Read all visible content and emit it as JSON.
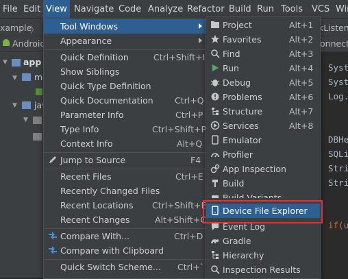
{
  "menubar": {
    "items": [
      "File",
      "Edit",
      "View",
      "Navigate",
      "Code",
      "Analyze",
      "Refactor",
      "Build",
      "Run",
      "Tools",
      "VCS",
      "Win"
    ],
    "active": "View"
  },
  "navbar": {
    "left": "xample",
    "right_tab": "kListen",
    "right_tab2": "onnectM"
  },
  "project_panel": {
    "root_label": "app",
    "tab_label": "Android",
    "items": [
      "m",
      "jav"
    ]
  },
  "editor_lines": [
    "Syst",
    "Syst",
    "Log.",
    "DBHe",
    "SQLi",
    "Stri",
    "Stri",
    "if(u"
  ],
  "view_menu": {
    "items": [
      {
        "label": "Tool Windows",
        "shortcut": "",
        "submenu": true
      },
      {
        "label": "Appearance",
        "shortcut": "",
        "submenu": true
      },
      {
        "label": "Quick Definition",
        "shortcut": "Ctrl+Shift+I"
      },
      {
        "label": "Show Siblings",
        "shortcut": ""
      },
      {
        "label": "Quick Type Definition",
        "shortcut": ""
      },
      {
        "label": "Quick Documentation",
        "shortcut": "Ctrl+Q"
      },
      {
        "label": "Parameter Info",
        "shortcut": "Ctrl+P"
      },
      {
        "label": "Type Info",
        "shortcut": "Ctrl+Shift+P"
      },
      {
        "label": "Context Info",
        "shortcut": "Alt+Q"
      },
      {
        "label": "Jump to Source",
        "shortcut": "F4"
      },
      {
        "label": "Recent Files",
        "shortcut": "Ctrl+E"
      },
      {
        "label": "Recently Changed Files",
        "shortcut": ""
      },
      {
        "label": "Recent Locations",
        "shortcut": "Ctrl+Shift+E"
      },
      {
        "label": "Recent Changes",
        "shortcut": "Alt+Shift+C"
      },
      {
        "label": "Compare With...",
        "shortcut": "Ctrl+D"
      },
      {
        "label": "Compare with Clipboard",
        "shortcut": ""
      },
      {
        "label": "Quick Switch Scheme...",
        "shortcut": "Ctrl+`"
      }
    ]
  },
  "tool_windows_menu": {
    "items": [
      {
        "label": "Project",
        "shortcut": "Alt+1",
        "icon": "folder-icon"
      },
      {
        "label": "Favorites",
        "shortcut": "Alt+2",
        "icon": "star-icon"
      },
      {
        "label": "Find",
        "shortcut": "Alt+3",
        "icon": "search-icon"
      },
      {
        "label": "Run",
        "shortcut": "Alt+4",
        "icon": "run-icon"
      },
      {
        "label": "Debug",
        "shortcut": "Alt+5",
        "icon": "bug-icon"
      },
      {
        "label": "Problems",
        "shortcut": "Alt+6",
        "icon": "problems-icon"
      },
      {
        "label": "Structure",
        "shortcut": "Alt+7",
        "icon": "structure-icon"
      },
      {
        "label": "Services",
        "shortcut": "Alt+8",
        "icon": "services-icon"
      },
      {
        "label": "Emulator",
        "shortcut": "",
        "icon": "emulator-icon"
      },
      {
        "label": "Profiler",
        "shortcut": "",
        "icon": "profiler-icon"
      },
      {
        "label": "App Inspection",
        "shortcut": "",
        "icon": "inspection-icon"
      },
      {
        "label": "Build",
        "shortcut": "",
        "icon": "hammer-icon"
      },
      {
        "label": "Build Variants",
        "shortcut": "",
        "icon": "build-variants-icon"
      },
      {
        "label": "Device File Explorer",
        "shortcut": "",
        "icon": "device-icon"
      },
      {
        "label": "Event Log",
        "shortcut": "",
        "icon": "event-log-icon"
      },
      {
        "label": "Gradle",
        "shortcut": "",
        "icon": "gradle-icon"
      },
      {
        "label": "Hierarchy",
        "shortcut": "",
        "icon": "hierarchy-icon"
      },
      {
        "label": "Inspection Results",
        "shortcut": "",
        "icon": "inspection-results-icon"
      }
    ]
  },
  "colors": {
    "highlight": "#2e5f92",
    "annotation_box": "#e0323a",
    "menu_bg": "#3c3f41"
  }
}
